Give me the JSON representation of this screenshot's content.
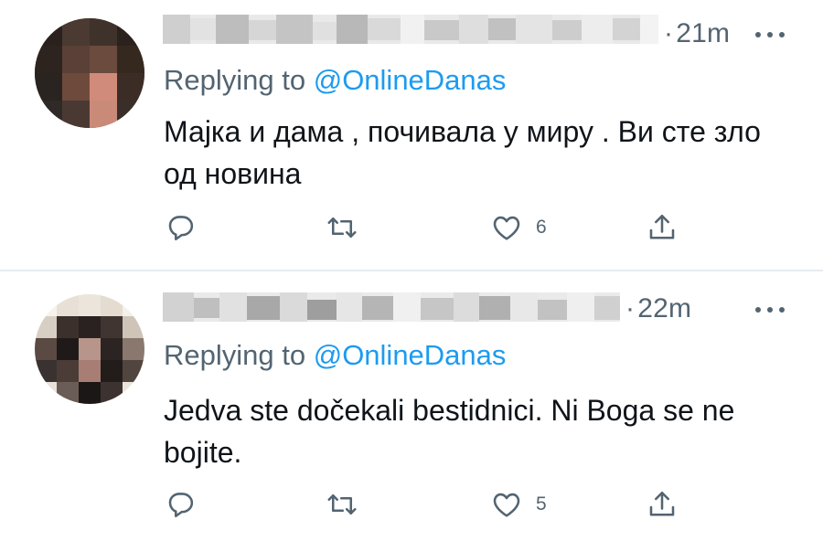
{
  "tweets": [
    {
      "time": "21m",
      "replying_prefix": "Replying to",
      "handle": "@OnlineDanas",
      "text": "Мајка и дама , почивала у миру . Ви сте зло од новина",
      "like_count": "6"
    },
    {
      "time": "22m",
      "replying_prefix": "Replying to",
      "handle": "@OnlineDanas",
      "text": "Jedva ste dočekali bestidnici. Ni Boga se ne bojite.",
      "like_count": "5"
    }
  ],
  "colors": {
    "secondary_text": "#536471",
    "link": "#1d9bf0",
    "divider": "#e6ecf0"
  },
  "icons": [
    "reply-icon",
    "retweet-icon",
    "like-icon",
    "share-icon",
    "more-icon"
  ]
}
